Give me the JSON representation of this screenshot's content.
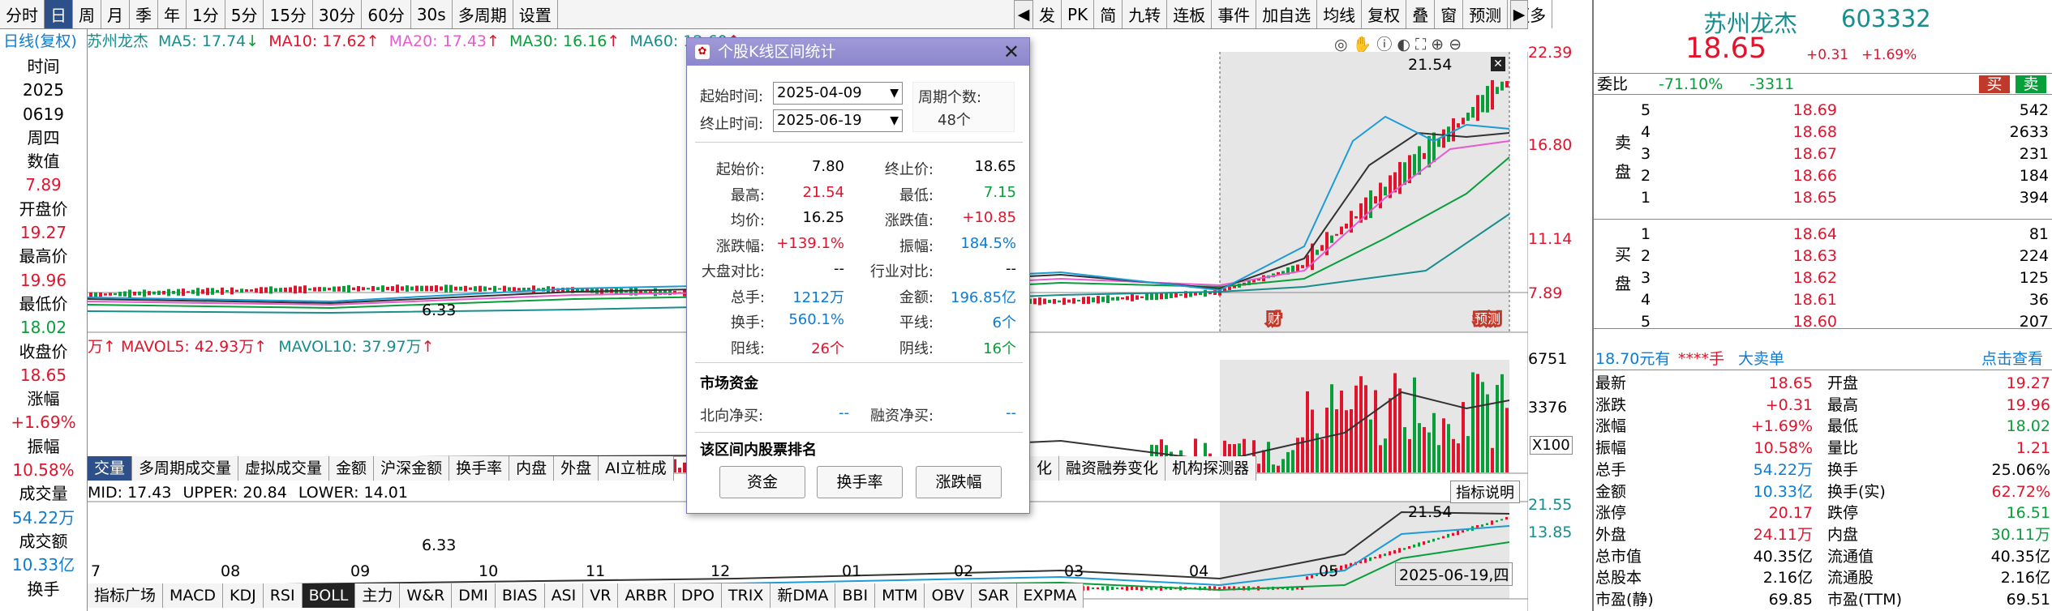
{
  "toolbar": {
    "items": [
      "分时",
      "日",
      "周",
      "月",
      "季",
      "年",
      "1分",
      "5分",
      "15分",
      "30分",
      "60分",
      "30s",
      "多周期",
      "设置"
    ],
    "right_items": [
      "发",
      "PK",
      "简",
      "九转",
      "连板",
      "事件",
      "加自选",
      "均线",
      "复权",
      "叠",
      "窗",
      "预测",
      "更多"
    ]
  },
  "info": {
    "labels": [
      "时间",
      "2025",
      "0619",
      "周四",
      "数值",
      "7.89",
      "开盘价",
      "19.27",
      "最高价",
      "19.96",
      "最低价",
      "18.02",
      "收盘价",
      "18.65",
      "涨幅",
      "+1.69%",
      "振幅",
      "10.58%",
      "成交量",
      "54.22万",
      "成交额",
      "10.33亿",
      "换手"
    ]
  },
  "ma_line": {
    "prefix": "日线(复权)",
    "name": "苏州龙杰",
    "ma5": "MA5: 17.74",
    "ma10": "MA10: 17.62",
    "ma20": "MA20: 17.43",
    "ma30": "MA30: 16.16",
    "ma60": "MA60: 12.60"
  },
  "axis_main": [
    "22.39",
    "16.80",
    "11.14",
    "7.89"
  ],
  "chart_labels": {
    "low": "6.33",
    "high": "21.54",
    "low2": "6.33",
    "high2": "21.54",
    "close_axis": "7.89",
    "x100": "X100",
    "cai": "财",
    "yuce": "预测"
  },
  "vol_line": {
    "mavol5": "MAVOL5: 42.93万",
    "mavol10": "MAVOL10: 37.97万"
  },
  "axis_vol": [
    "6751",
    "3376"
  ],
  "boll_line": {
    "mid": "MID: 17.43",
    "upper": "UPPER: 20.84",
    "lower": "LOWER: 14.01"
  },
  "axis_boll": [
    "21.55",
    "13.85"
  ],
  "boll_btn": "指标说明",
  "x_axis": [
    "7",
    "08",
    "09",
    "10",
    "11",
    "12",
    "01",
    "02",
    "03",
    "04",
    "05",
    "2025-06-19,四"
  ],
  "mid_tabs": [
    "交量",
    "多周期成交量",
    "虚拟成交量",
    "金额",
    "沪深金额",
    "换手率",
    "内盘",
    "外盘",
    "AI立桩成"
  ],
  "mid_tabs2": [
    "化",
    "融资融券变化",
    "机构探测器"
  ],
  "bottom_tabs": [
    "指标广场",
    "MACD",
    "KDJ",
    "RSI",
    "BOLL",
    "主力",
    "W&R",
    "DMI",
    "BIAS",
    "ASI",
    "VR",
    "ARBR",
    "DPO",
    "TRIX",
    "新DMA",
    "BBI",
    "MTM",
    "OBV",
    "SAR",
    "EXPMA"
  ],
  "dialog": {
    "title": "个股K线区间统计",
    "start_label": "起始时间:",
    "start": "2025-04-09",
    "end_label": "终止时间:",
    "end": "2025-06-19",
    "period_label": "周期个数:",
    "period": "48个",
    "rows": [
      [
        "起始价:",
        "7.80",
        "终止价:",
        "18.65"
      ],
      [
        "最高:",
        "21.54",
        "最低:",
        "7.15"
      ],
      [
        "均价:",
        "16.25",
        "涨跌值:",
        "+10.85"
      ],
      [
        "涨跌幅:",
        "+139.1%",
        "振幅:",
        "184.5%"
      ],
      [
        "大盘对比:",
        "--",
        "行业对比:",
        "--"
      ],
      [
        "总手:",
        "1212万",
        "金额:",
        "196.85亿"
      ],
      [
        "换手:",
        "560.1%",
        "平线:",
        "6个"
      ],
      [
        "阳线:",
        "26个",
        "阴线:",
        "16个"
      ]
    ],
    "fund_title": "市场资金",
    "north_label": "北向净买:",
    "north": "--",
    "margin_label": "融资净买:",
    "margin": "--",
    "rank_title": "该区间内股票排名",
    "btns": [
      "资金",
      "换手率",
      "涨跌幅"
    ]
  },
  "quote": {
    "name": "苏州龙杰",
    "code": "603332",
    "price": "18.65",
    "change": "+0.31",
    "pct": "+1.69%",
    "weibi_label": "委比",
    "weibi": "-71.10%",
    "weicha": "-3311",
    "buy": "买",
    "sell": "卖",
    "asks": [
      [
        "5",
        "18.69",
        "542"
      ],
      [
        "4",
        "18.68",
        "2633"
      ],
      [
        "3",
        "18.67",
        "231"
      ],
      [
        "2",
        "18.66",
        "184"
      ],
      [
        "1",
        "18.65",
        "394"
      ]
    ],
    "bids": [
      [
        "1",
        "18.64",
        "81"
      ],
      [
        "2",
        "18.63",
        "224"
      ],
      [
        "3",
        "18.62",
        "125"
      ],
      [
        "4",
        "18.61",
        "36"
      ],
      [
        "5",
        "18.60",
        "207"
      ]
    ],
    "sell_side": "卖盘",
    "buy_side": "买盘",
    "big_order": {
      "price": "18.70元有",
      "qty": "****手",
      "label": "大卖单",
      "link": "点击查看"
    },
    "stats": [
      [
        "最新",
        "18.65",
        "开盘",
        "19.27"
      ],
      [
        "涨跌",
        "+0.31",
        "最高",
        "19.96"
      ],
      [
        "涨幅",
        "+1.69%",
        "最低",
        "18.02"
      ],
      [
        "振幅",
        "10.58%",
        "量比",
        "1.21"
      ],
      [
        "总手",
        "54.22万",
        "换手",
        "25.06%"
      ],
      [
        "金额",
        "10.33亿",
        "换手(实)",
        "62.72%"
      ],
      [
        "涨停",
        "20.17",
        "跌停",
        "16.51"
      ],
      [
        "外盘",
        "24.11万",
        "内盘",
        "30.11万"
      ],
      [
        "总市值",
        "40.35亿",
        "流通值",
        "40.35亿"
      ],
      [
        "总股本",
        "2.16亿",
        "流通股",
        "2.16亿"
      ],
      [
        "市盈(静)",
        "69.85",
        "市盈(TTM)",
        "69.51"
      ]
    ]
  },
  "colors": {
    "up": "#e0142c",
    "down": "#089e3a",
    "accent": "#2d4f8a"
  }
}
